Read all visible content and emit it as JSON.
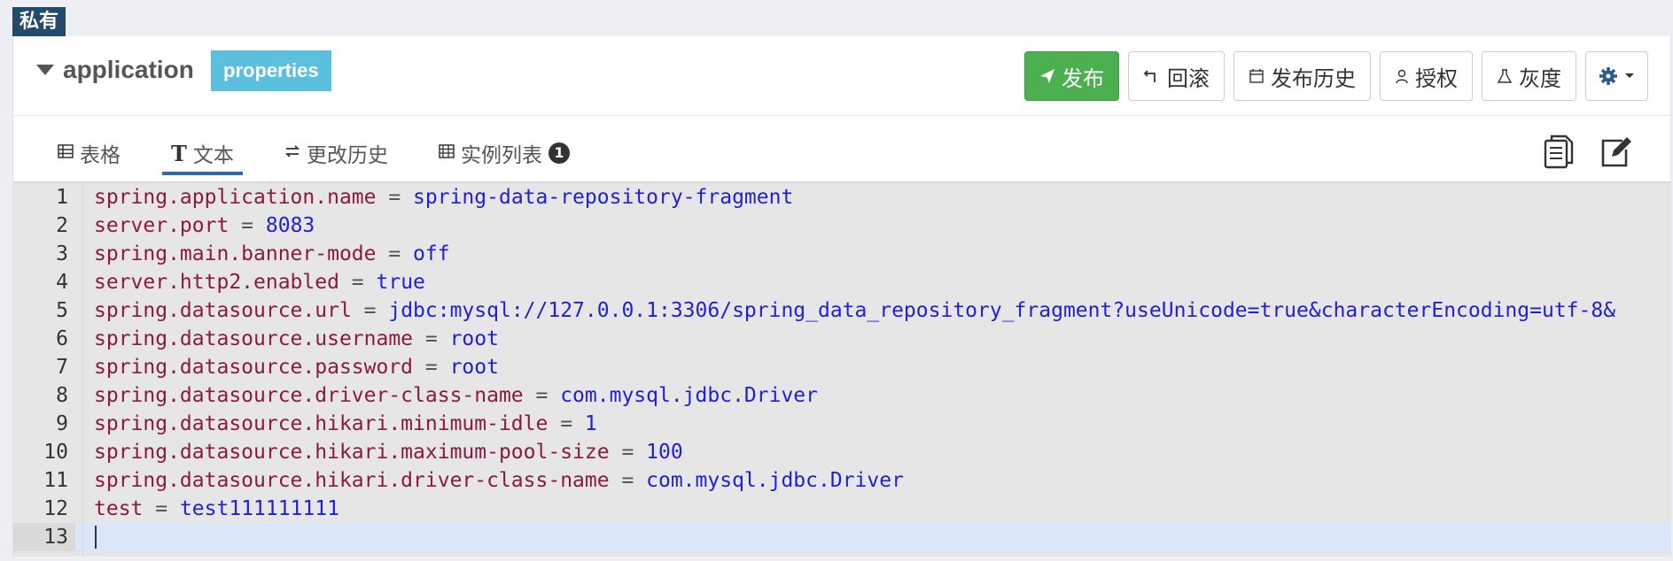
{
  "badge": "私有",
  "namespace": {
    "name": "application",
    "format": "properties"
  },
  "toolbar": {
    "publish": "发布",
    "rollback": "回滚",
    "history": "发布历史",
    "authorize": "授权",
    "gray": "灰度"
  },
  "tabs": {
    "table": "表格",
    "text": "文本",
    "change_history": "更改历史",
    "instances": "实例列表",
    "instances_count": "1"
  },
  "editor": {
    "lines": [
      {
        "n": "1",
        "key": "spring.application.name",
        "op": " = ",
        "val": "spring-data-repository-fragment"
      },
      {
        "n": "2",
        "key": "server.port",
        "op": " = ",
        "val": "8083"
      },
      {
        "n": "3",
        "key": "spring.main.banner-mode",
        "op": " = ",
        "val": "off"
      },
      {
        "n": "4",
        "key": "server.http2.enabled",
        "op": " = ",
        "val": "true"
      },
      {
        "n": "5",
        "key": "spring.datasource.url",
        "op": " = ",
        "val": "jdbc:mysql://127.0.0.1:3306/spring_data_repository_fragment?useUnicode=true&characterEncoding=utf-8&"
      },
      {
        "n": "6",
        "key": "spring.datasource.username",
        "op": " = ",
        "val": "root"
      },
      {
        "n": "7",
        "key": "spring.datasource.password",
        "op": " = ",
        "val": "root"
      },
      {
        "n": "8",
        "key": "spring.datasource.driver-class-name",
        "op": " = ",
        "val": "com.mysql.jdbc.Driver"
      },
      {
        "n": "9",
        "key": "spring.datasource.hikari.minimum-idle",
        "op": " = ",
        "val": "1"
      },
      {
        "n": "10",
        "key": "spring.datasource.hikari.maximum-pool-size",
        "op": " = ",
        "val": "100"
      },
      {
        "n": "11",
        "key": "spring.datasource.hikari.driver-class-name",
        "op": " = ",
        "val": "com.mysql.jdbc.Driver"
      },
      {
        "n": "12",
        "key": "test",
        "op": " = ",
        "val": "test111111111"
      },
      {
        "n": "13",
        "key": "",
        "op": "",
        "val": ""
      }
    ]
  },
  "colors": {
    "primary_button": "#4caf50",
    "format_badge": "#5bc0de",
    "private_badge": "#224a6a",
    "key_text": "#8b1a3c",
    "value_text": "#1f1fd6"
  },
  "icons": {
    "caret": "caret-down-icon",
    "publish": "send-icon",
    "rollback": "undo-icon",
    "history": "calendar-icon",
    "authorize": "user-icon",
    "gray": "flask-icon",
    "settings": "gear-icon",
    "copy": "copy-icon",
    "edit": "edit-icon"
  }
}
